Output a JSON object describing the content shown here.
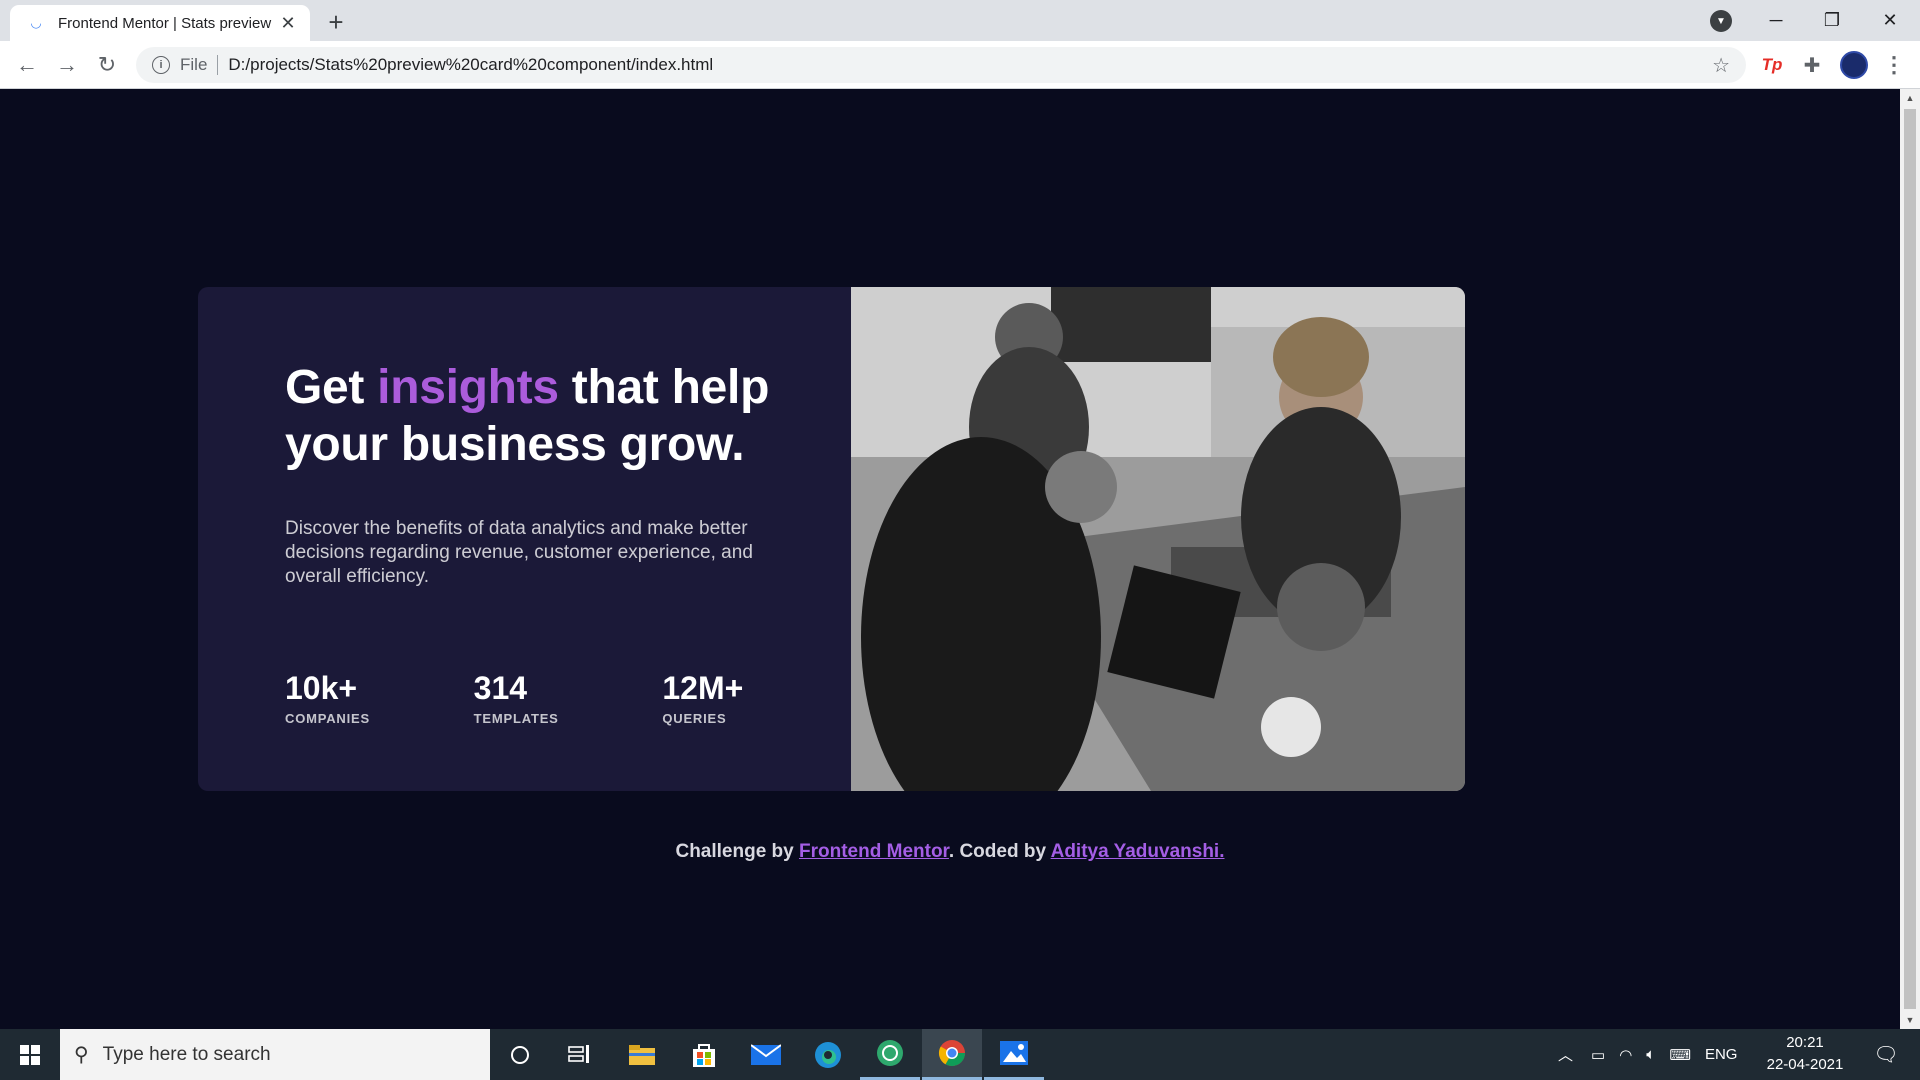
{
  "browser": {
    "tab_title": "Frontend Mentor | Stats preview",
    "url_scheme": "File",
    "url": "D:/projects/Stats%20preview%20card%20component/index.html"
  },
  "card": {
    "headline_pre": "Get ",
    "headline_accent": "insights",
    "headline_post": " that help your business grow.",
    "description": "Discover the benefits of data analytics and make better decisions regarding revenue, customer experience, and overall efficiency.",
    "stats": [
      {
        "value": "10k+",
        "label": "COMPANIES"
      },
      {
        "value": "314",
        "label": "TEMPLATES"
      },
      {
        "value": "12M+",
        "label": "QUERIES"
      }
    ]
  },
  "attribution": {
    "prefix": "Challenge by ",
    "link1": "Frontend Mentor",
    "middle": ". Coded by ",
    "link2": "Aditya Yaduvanshi."
  },
  "taskbar": {
    "search_placeholder": "Type here to search",
    "language": "ENG",
    "time": "20:21",
    "date": "22-04-2021"
  },
  "colors": {
    "page_bg": "#090b1e",
    "card_bg": "#1b1938",
    "accent": "#ab5cdb",
    "link": "#a45ee5"
  },
  "icons": [
    "back-arrow-icon",
    "forward-arrow-icon",
    "reload-icon",
    "info-icon",
    "star-icon",
    "puzzle-icon",
    "kebab-menu-icon",
    "windows-start-icon",
    "search-icon",
    "cortana-icon",
    "task-view-icon",
    "file-explorer-icon",
    "store-icon",
    "mail-icon",
    "edge-icon",
    "chrome-icon",
    "photos-icon",
    "notification-icon"
  ]
}
